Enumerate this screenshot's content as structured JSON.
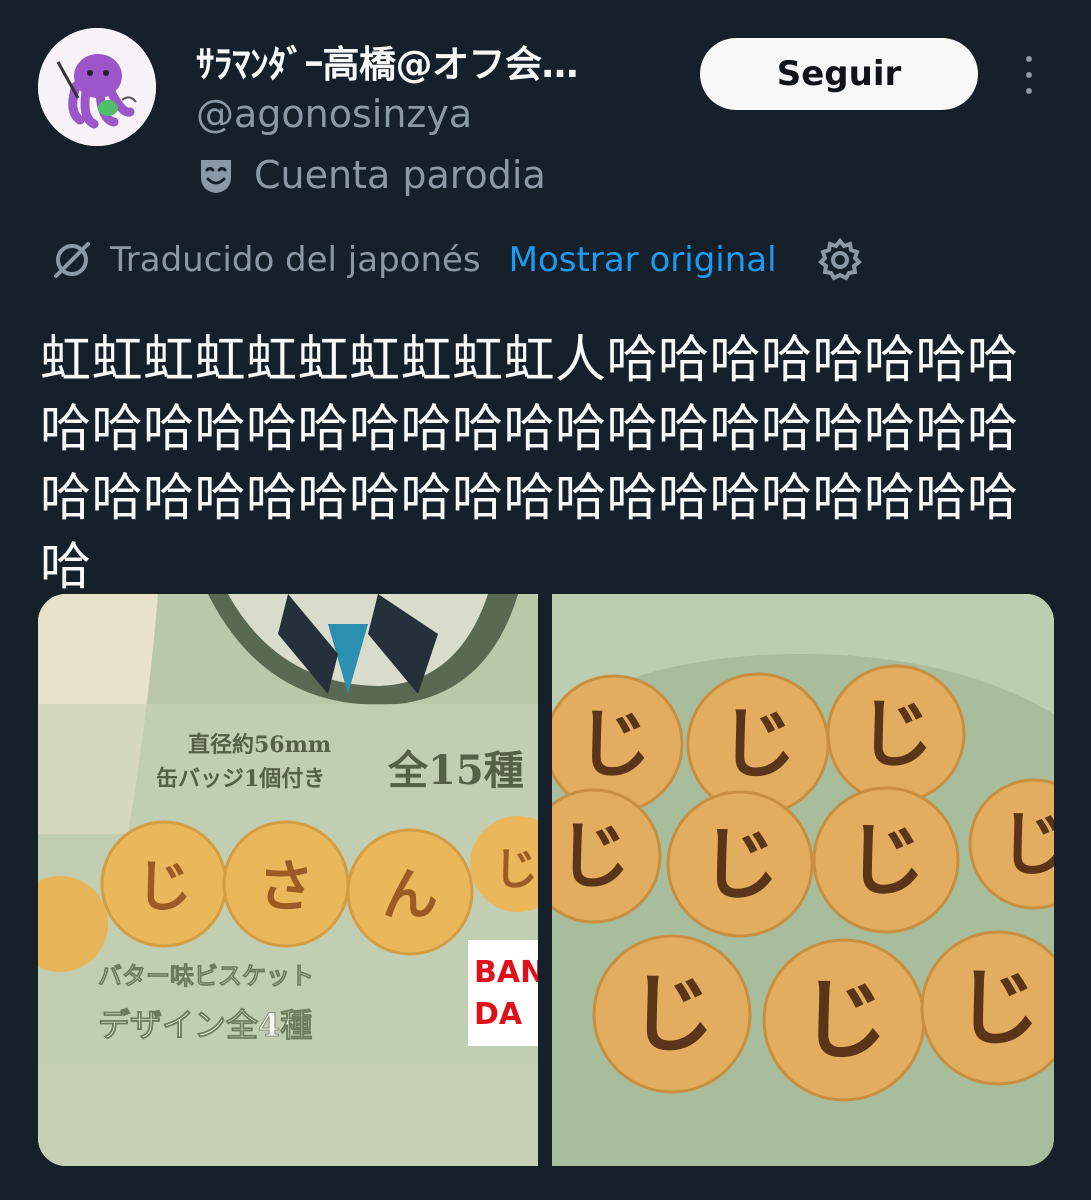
{
  "user": {
    "display_name": "ｻﾗﾏﾝﾀﾞｰ高橋@オフ会…",
    "handle": "@agonosinzya",
    "badge_label": "Cuenta parodia",
    "badge_icon": "theater-mask-icon",
    "avatar_icon": "purple-octopus-avatar"
  },
  "actions": {
    "follow_label": "Seguir",
    "more_icon": "more-vertical-icon"
  },
  "translation": {
    "icon": "translate-slash-icon",
    "label": "Traducido del japonés",
    "show_original_label": "Mostrar original",
    "settings_icon": "gear-icon",
    "link_color": "#1d9bf0"
  },
  "tweet": {
    "text": "虹虹虹虹虹虹虹虹虹虹人哈哈哈哈哈哈哈哈哈哈哈哈哈哈哈哈哈哈哈哈哈哈哈哈哈哈哈哈哈哈哈哈哈哈哈哈哈哈哈哈哈哈哈哈哈哈哈"
  },
  "media": {
    "left": {
      "package_text_1": "直径約56mm",
      "package_text_2": "缶バッジ1個付き",
      "package_text_3": "全15種",
      "cookie_letters": [
        "じ",
        "じ",
        "さ",
        "ん",
        "じ"
      ],
      "flavor_text": "バター味ビスケット",
      "design_text": "デザイン全4種",
      "brand_text_1": "BAN",
      "brand_text_2": "DA"
    },
    "right": {
      "cookie_letter": "じ"
    }
  },
  "colors": {
    "background": "#15202b",
    "text_primary": "#f7f9f9",
    "text_secondary": "#8b98a5",
    "button_bg": "#f7f9f9"
  }
}
